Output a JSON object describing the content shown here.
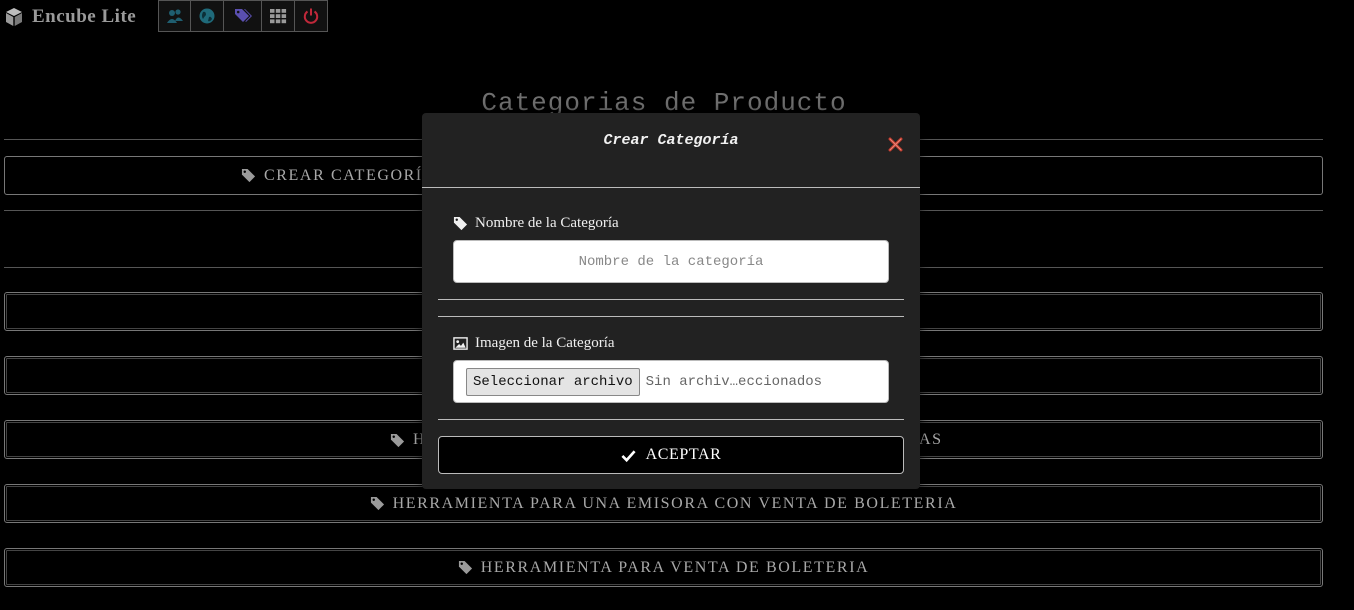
{
  "app": {
    "name": "Encube Lite"
  },
  "nav": {
    "icons": [
      "users-icon",
      "globe-icon",
      "tags-icon",
      "grid-icon",
      "power-icon"
    ],
    "colors": {
      "users": "#1f5e70",
      "globe": "#1f6a7a",
      "tags": "#5a4fb0",
      "grid": "#9a9a9a",
      "power": "#c0283a"
    }
  },
  "page": {
    "title": "Categorias de Producto",
    "create_button": "CREAR CATEGORÍA",
    "rows": [
      {
        "left": "H",
        "right": "AS"
      },
      {
        "label": "HERRAMIENTA PARA UNA EMISORA CON VENTA DE BOLETERIA"
      },
      {
        "label": "HERRAMIENTA PARA VENTA DE BOLETERIA"
      }
    ]
  },
  "modal": {
    "title": "Crear Categoría",
    "name_label": "Nombre de la Categoría",
    "name_placeholder": "Nombre de la categoría",
    "image_label": "Imagen de la Categoría",
    "file_button": "Seleccionar archivo",
    "file_status": "Sin archiv…eccionados",
    "accept_button": "ACEPTAR"
  }
}
